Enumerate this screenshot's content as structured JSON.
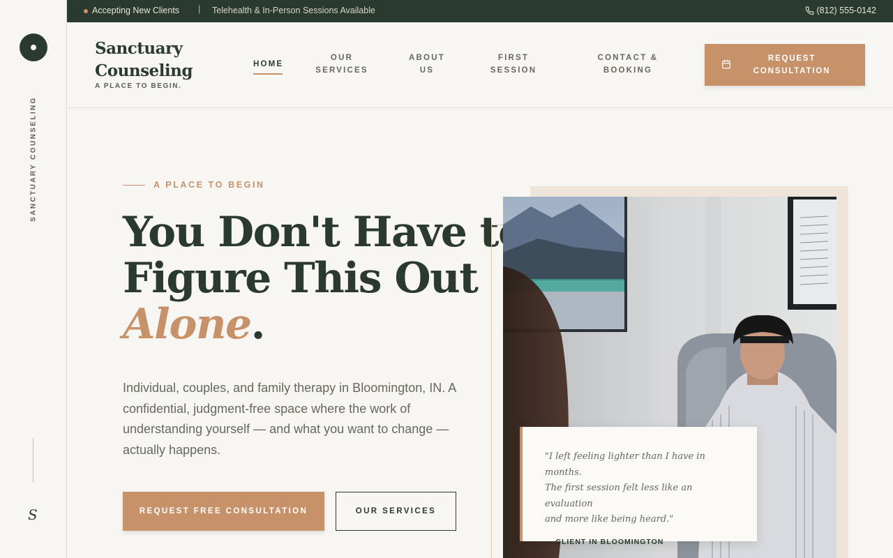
{
  "rail": {
    "vertical_text": "SANCTUARY COUNSELING",
    "monogram": "S"
  },
  "topbar": {
    "status": "Accepting New Clients",
    "separator": "|",
    "sessions": "Telehealth & In-Person Sessions Available",
    "phone": "(812) 555-0142"
  },
  "brand": {
    "name_line1": "Sanctuary",
    "name_line2": "Counseling",
    "tagline": "A PLACE TO BEGIN."
  },
  "nav": {
    "home": "HOME",
    "services_l1": "OUR",
    "services_l2": "SERVICES",
    "about_l1": "ABOUT",
    "about_l2": "US",
    "first_l1": "FIRST",
    "first_l2": "SESSION",
    "contact_l1": "CONTACT &",
    "contact_l2": "BOOKING",
    "cta_l1": "REQUEST",
    "cta_l2": "CONSULTATION"
  },
  "hero": {
    "eyebrow": "A PLACE TO BEGIN",
    "headline_l1": "You Don't Have to",
    "headline_l2": "Figure This Out",
    "headline_accent": "Alone",
    "headline_period": ".",
    "lede": "Individual, couples, and family therapy in Bloomington, IN. A confidential, judgment-free space where the work of understanding yourself — and what you want to change — actually happens.",
    "primary_button": "REQUEST FREE CONSULTATION",
    "secondary_button": "OUR SERVICES"
  },
  "testimonial": {
    "quote_l1": "\"I left feeling lighter than I have in months.",
    "quote_l2": "The first session felt less like an evaluation",
    "quote_l3": "and more like being heard.\"",
    "attribution": "— CLIENT IN BLOOMINGTON"
  },
  "colors": {
    "forest": "#2b3a2e",
    "clay": "#c7916a",
    "cream": "#f8f6f2",
    "sand": "#eee4d9"
  },
  "icons": {
    "phone": "phone-icon",
    "calendar": "calendar-icon"
  }
}
